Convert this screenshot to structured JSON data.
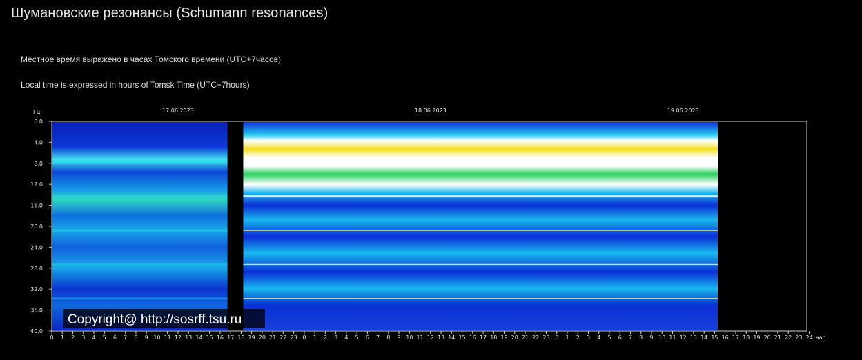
{
  "header": {
    "title": "Шумановские резонансы (Schumann resonances)",
    "subtitle_ru": "Местное время выражено в часах Томского времени (UTC+7часов)",
    "subtitle_en": "Local time is expressed in hours of Tomsk Time (UTC+7hours)"
  },
  "chart_data": {
    "type": "heatmap",
    "ylabel": "Гц",
    "xlabel": "час",
    "ylim": [
      0,
      40
    ],
    "y_ticks": [
      "0.0",
      "4.0",
      "8.0",
      "12.0",
      "16.0",
      "20.0",
      "24.0",
      "28.0",
      "32.0",
      "36.0",
      "40.0"
    ],
    "x_ticks": [
      "0",
      "1",
      "2",
      "3",
      "4",
      "5",
      "6",
      "7",
      "8",
      "9",
      "10",
      "11",
      "12",
      "13",
      "14",
      "15",
      "16",
      "17",
      "18",
      "19",
      "20",
      "21",
      "22",
      "23",
      "0",
      "1",
      "2",
      "3",
      "4",
      "5",
      "6",
      "7",
      "8",
      "9",
      "10",
      "11",
      "12",
      "13",
      "14",
      "15",
      "16",
      "17",
      "18",
      "19",
      "20",
      "21",
      "22",
      "23",
      "0",
      "1",
      "2",
      "3",
      "4",
      "5",
      "6",
      "7",
      "8",
      "9",
      "10",
      "11",
      "12",
      "13",
      "14",
      "15",
      "16",
      "17",
      "18",
      "19",
      "20",
      "21",
      "22",
      "23",
      "24"
    ],
    "dates": [
      {
        "label": "17.06.2023",
        "hour": 12
      },
      {
        "label": "18.06.2023",
        "hour": 36
      },
      {
        "label": "19.06.2023",
        "hour": 60
      }
    ],
    "data_segments": [
      {
        "start_hour": 0,
        "end_hour": 16.7,
        "style": "quiet"
      },
      {
        "start_hour": 18.2,
        "end_hour": 63.3,
        "style": "strong"
      }
    ],
    "resonance_bands_hz": [
      7.8,
      14.3,
      20.8,
      27.3,
      33.8
    ],
    "watermark": "Copyright@ http://sosrff.tsu.ru",
    "colors": {
      "background": "#000000",
      "low": "#0a2fd6",
      "mid": "#18c8f0",
      "high": "#f0e020",
      "peak": "#ffffff"
    }
  }
}
